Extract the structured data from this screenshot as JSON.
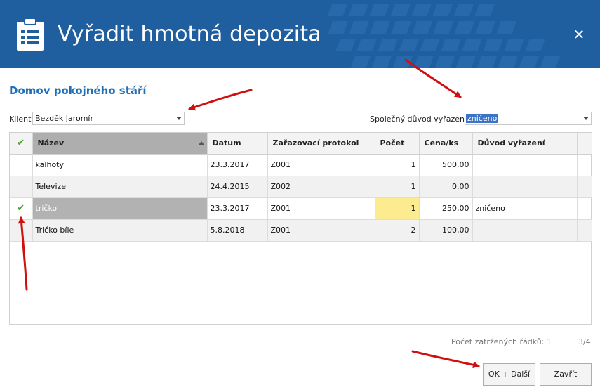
{
  "dialog": {
    "title": "Vyřadit hmotná depozita",
    "close_glyph": "✕",
    "subtitle": "Domov pokojného stáří"
  },
  "client": {
    "label": "Klient:",
    "value": "Bezděk Jaromír"
  },
  "common_reason": {
    "label": "Společný důvod vyřazení:",
    "value": "zničeno"
  },
  "grid": {
    "columns": [
      "",
      "Název",
      "Datum",
      "Zařazovací protokol",
      "Počet",
      "Cena/ks",
      "Důvod vyřazení"
    ],
    "sorted_column": "Název",
    "rows": [
      {
        "checked": false,
        "name": "kalhoty",
        "date": "23.3.2017",
        "protocol": "Z001",
        "count": "1",
        "price": "500,00",
        "reason": ""
      },
      {
        "checked": false,
        "name": "Televize",
        "date": "24.4.2015",
        "protocol": "Z002",
        "count": "1",
        "price": "0,00",
        "reason": ""
      },
      {
        "checked": true,
        "name": "tričko",
        "date": "23.3.2017",
        "protocol": "Z001",
        "count": "1",
        "price": "250,00",
        "reason": "zničeno"
      },
      {
        "checked": false,
        "name": "Tričko bíle",
        "date": "5.8.2018",
        "protocol": "Z001",
        "count": "2",
        "price": "100,00",
        "reason": ""
      }
    ]
  },
  "footer": {
    "checked_rows_label": "Počet zatržených řádků: 1",
    "position": "3/4"
  },
  "buttons": {
    "ok_next": "OK + Další",
    "close": "Zavřít"
  },
  "colors": {
    "header_bg": "#1f5f9f",
    "subtitle": "#1f6fb5",
    "check": "#4aa02c",
    "edit_cell": "#fdeb8f",
    "annotation_arrow": "#d01010"
  },
  "icons": [
    "clipboard-list-icon",
    "close-icon",
    "check-icon",
    "sort-asc-icon",
    "dropdown-arrow-icon"
  ]
}
